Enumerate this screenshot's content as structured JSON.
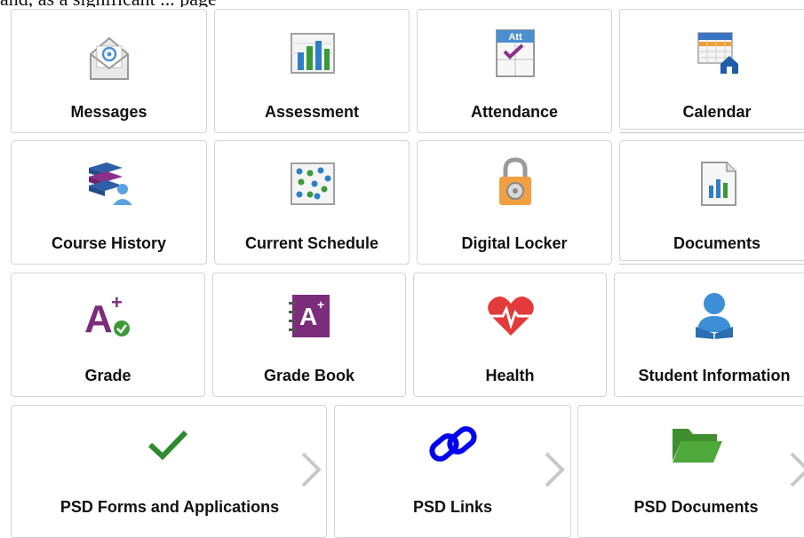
{
  "header": {
    "partial_text": "and, as a significant ... page"
  },
  "tiles": [
    {
      "label": "Messages",
      "icon": "envelope-email-icon"
    },
    {
      "label": "Assessment",
      "icon": "bar-chart-icon"
    },
    {
      "label": "Attendance",
      "icon": "attendance-checklist-icon",
      "icon_text": "Att"
    },
    {
      "label": "Calendar",
      "icon": "calendar-school-icon"
    },
    {
      "label": "Course History",
      "icon": "stacked-books-icon"
    },
    {
      "label": "Current Schedule",
      "icon": "schedule-grid-icon"
    },
    {
      "label": "Digital Locker",
      "icon": "padlock-icon"
    },
    {
      "label": "Documents",
      "icon": "document-chart-icon"
    },
    {
      "label": "Grade",
      "icon": "grade-a-plus-icon"
    },
    {
      "label": "Grade Book",
      "icon": "gradebook-icon"
    },
    {
      "label": "Health",
      "icon": "heart-pulse-icon"
    },
    {
      "label": "Student Information",
      "icon": "student-reading-icon"
    },
    {
      "label": "PSD Forms and Applications",
      "icon": "checkmark-icon"
    },
    {
      "label": "PSD Links",
      "icon": "link-chain-icon"
    },
    {
      "label": "PSD Documents",
      "icon": "folder-open-icon"
    }
  ],
  "colors": {
    "border": "#d4d4d4",
    "check_green": "#2e8b2e",
    "link_blue": "#0000ee",
    "folder_green": "#3f8f2f",
    "heart_red": "#e33b3b",
    "grade_purple": "#7b2d7b",
    "student_blue": "#3d8fd6",
    "chevron_gray": "#c8c8c8"
  }
}
